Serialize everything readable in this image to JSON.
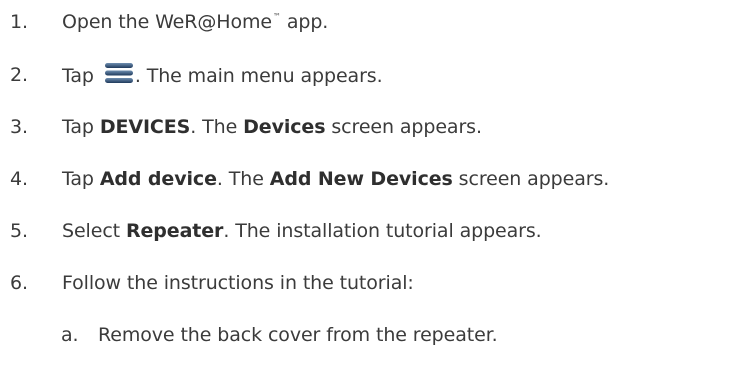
{
  "steps": [
    {
      "number": "1.",
      "parts": [
        "Open the WeR@Home",
        "™",
        " app."
      ]
    },
    {
      "number": "2.",
      "parts": [
        "Tap ",
        ". The main menu appears."
      ],
      "icon": "hamburger-menu-icon"
    },
    {
      "number": "3.",
      "parts": [
        "Tap ",
        "DEVICES",
        ". The ",
        "Devices",
        " screen appears."
      ]
    },
    {
      "number": "4.",
      "parts": [
        "Tap ",
        "Add device",
        ". The ",
        "Add New Devices",
        " screen appears."
      ]
    },
    {
      "number": "5.",
      "parts": [
        "Select ",
        "Repeater",
        ". The installation tutorial appears."
      ]
    },
    {
      "number": "6.",
      "parts": [
        "Follow the instructions in the tutorial:"
      ]
    }
  ],
  "substeps": [
    {
      "number": "a.",
      "text": "Remove the back cover from the repeater."
    }
  ],
  "colors": {
    "text": "#3b3b3b",
    "icon_top": "#6f8fb1",
    "icon_bottom": "#1f3a5c"
  }
}
